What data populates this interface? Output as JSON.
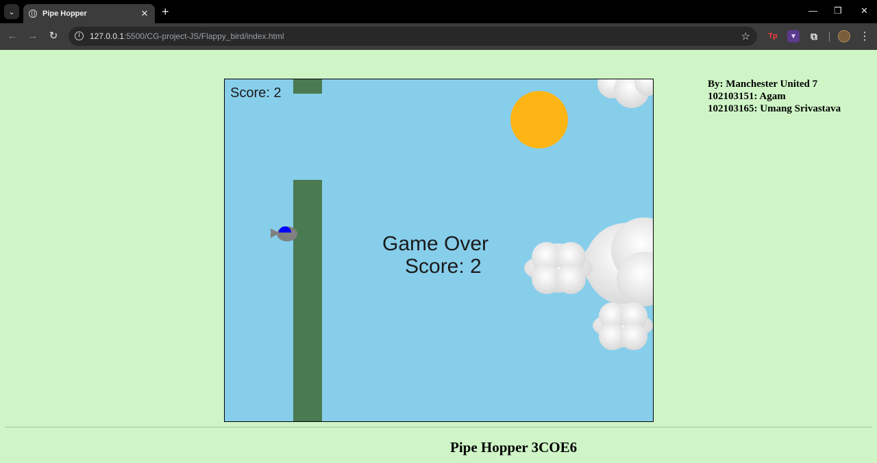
{
  "browser": {
    "tab_title": "Pipe Hopper",
    "url_host": "127.0.0.1",
    "url_rest": ":5500/CG-project-JS/Flappy_bird/index.html",
    "extensions": [
      "Tp"
    ]
  },
  "game": {
    "score_label": "Score: 2",
    "game_over_text": "Game Over",
    "final_score_text": "Score: 2",
    "score": 2,
    "state": "game-over",
    "colors": {
      "sky": "#87ceeb",
      "pipe": "#4a7a52",
      "sun": "#fdb515",
      "bird_body": "#808080",
      "bird_head": "#0000ff"
    }
  },
  "credits": {
    "line1": "By: Manchester United 7",
    "line2": "102103151: Agam",
    "line3": "102103165: Umang Srivastava"
  },
  "footer": {
    "title": "Pipe Hopper 3COE6"
  }
}
